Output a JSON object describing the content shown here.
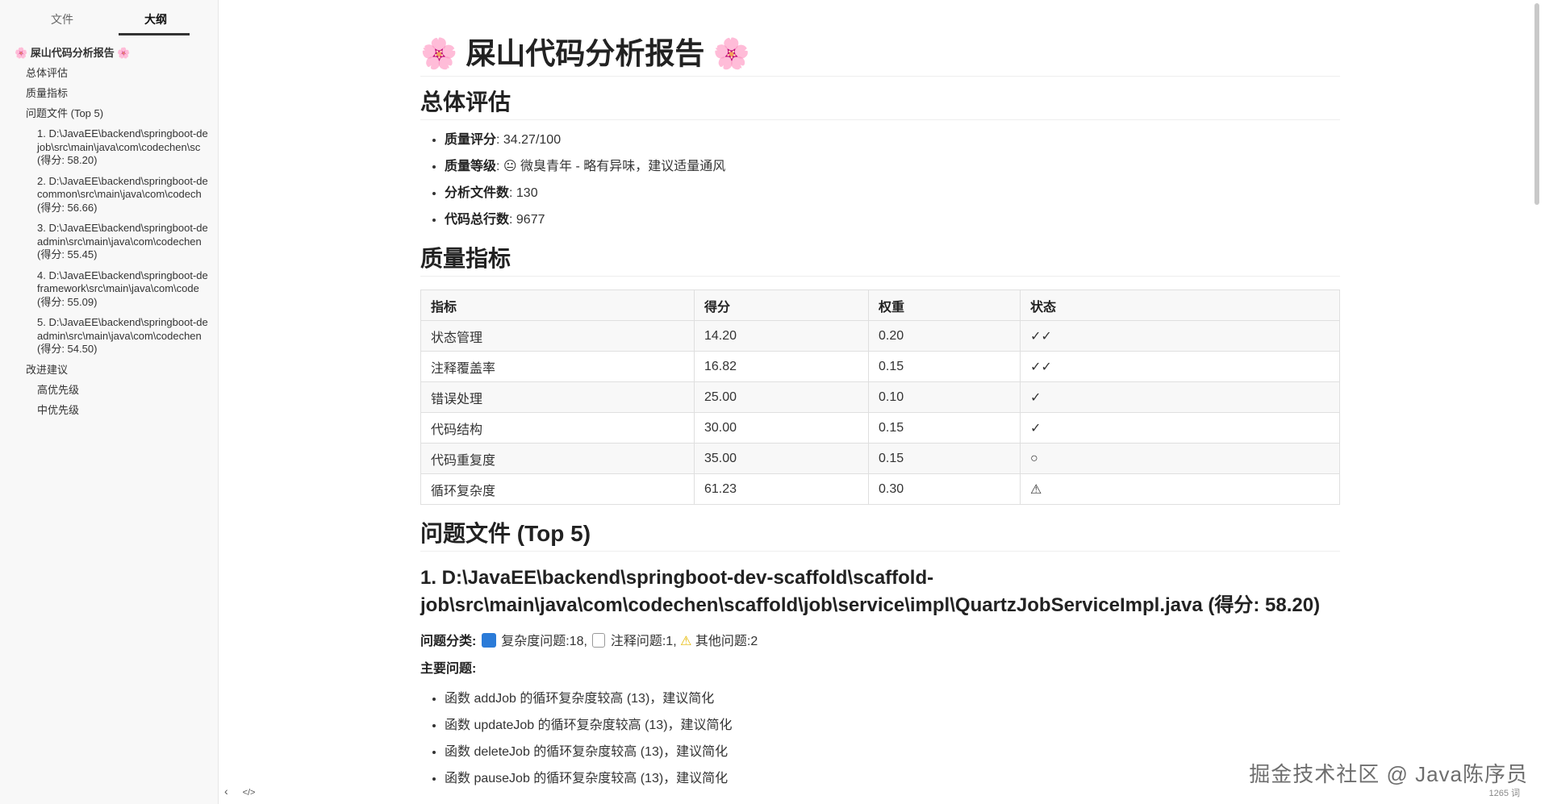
{
  "tabs": {
    "file": "文件",
    "outline": "大纲"
  },
  "outline": {
    "root": "🌸 屎山代码分析报告 🌸",
    "summary": "总体评估",
    "metrics": "质量指标",
    "problems": "问题文件 (Top 5)",
    "files": [
      {
        "line1": "1. D:\\JavaEE\\backend\\springboot-de",
        "line2": "job\\src\\main\\java\\com\\codechen\\sc",
        "line3": "(得分: 58.20)"
      },
      {
        "line1": "2. D:\\JavaEE\\backend\\springboot-de",
        "line2": "common\\src\\main\\java\\com\\codech",
        "line3": "(得分: 56.66)"
      },
      {
        "line1": "3. D:\\JavaEE\\backend\\springboot-de",
        "line2": "admin\\src\\main\\java\\com\\codechen",
        "line3": "(得分: 55.45)"
      },
      {
        "line1": "4. D:\\JavaEE\\backend\\springboot-de",
        "line2": "framework\\src\\main\\java\\com\\code",
        "line3": "(得分: 55.09)"
      },
      {
        "line1": "5. D:\\JavaEE\\backend\\springboot-de",
        "line2": "admin\\src\\main\\java\\com\\codechen",
        "line3": "(得分: 54.50)"
      }
    ],
    "suggestions": "改进建议",
    "high": "高优先级",
    "mid": "中优先级"
  },
  "footer": {
    "back": "‹",
    "source": "</>"
  },
  "doc": {
    "title": "🌸 屎山代码分析报告 🌸",
    "h_summary": "总体评估",
    "summary_items": [
      {
        "label": "质量评分",
        "value": ": 34.27/100"
      },
      {
        "label": "质量等级",
        "value": ": 😐 微臭青年 - 略有异味，建议适量通风"
      },
      {
        "label": "分析文件数",
        "value": ": 130"
      },
      {
        "label": "代码总行数",
        "value": ": 9677"
      }
    ],
    "h_metrics": "质量指标",
    "table_headers": [
      "指标",
      "得分",
      "权重",
      "状态"
    ],
    "table_rows": [
      [
        "状态管理",
        "14.20",
        "0.20",
        "✓✓"
      ],
      [
        "注释覆盖率",
        "16.82",
        "0.15",
        "✓✓"
      ],
      [
        "错误处理",
        "25.00",
        "0.10",
        "✓"
      ],
      [
        "代码结构",
        "30.00",
        "0.15",
        "✓"
      ],
      [
        "代码重复度",
        "35.00",
        "0.15",
        "○"
      ],
      [
        "循环复杂度",
        "61.23",
        "0.30",
        "⚠"
      ]
    ],
    "h_problems": "问题文件 (Top 5)",
    "file1_heading": "1. D:\\JavaEE\\backend\\springboot-dev-scaffold\\scaffold-job\\src\\main\\java\\com\\codechen\\scaffold\\job\\service\\impl\\QuartzJobServiceImpl.java (得分: 58.20)",
    "category_label": "问题分类",
    "category_complexity": "复杂度问题:18,",
    "category_comment": "注释问题:1,",
    "category_other": "其他问题:2",
    "main_issues_label": "主要问题",
    "issues": [
      "函数 addJob 的循环复杂度较高 (13)，建议简化",
      "函数 updateJob 的循环复杂度较高 (13)，建议简化",
      "函数 deleteJob 的循环复杂度较高 (13)，建议简化",
      "函数 pauseJob 的循环复杂度较高 (13)，建议简化"
    ]
  },
  "watermark": "掘金技术社区 @ Java陈序员",
  "word_count": "1265 词",
  "colors": {
    "sidebar_bg": "#f8f8f8",
    "table_header_bg": "#f8f8f8",
    "text": "#333333"
  }
}
